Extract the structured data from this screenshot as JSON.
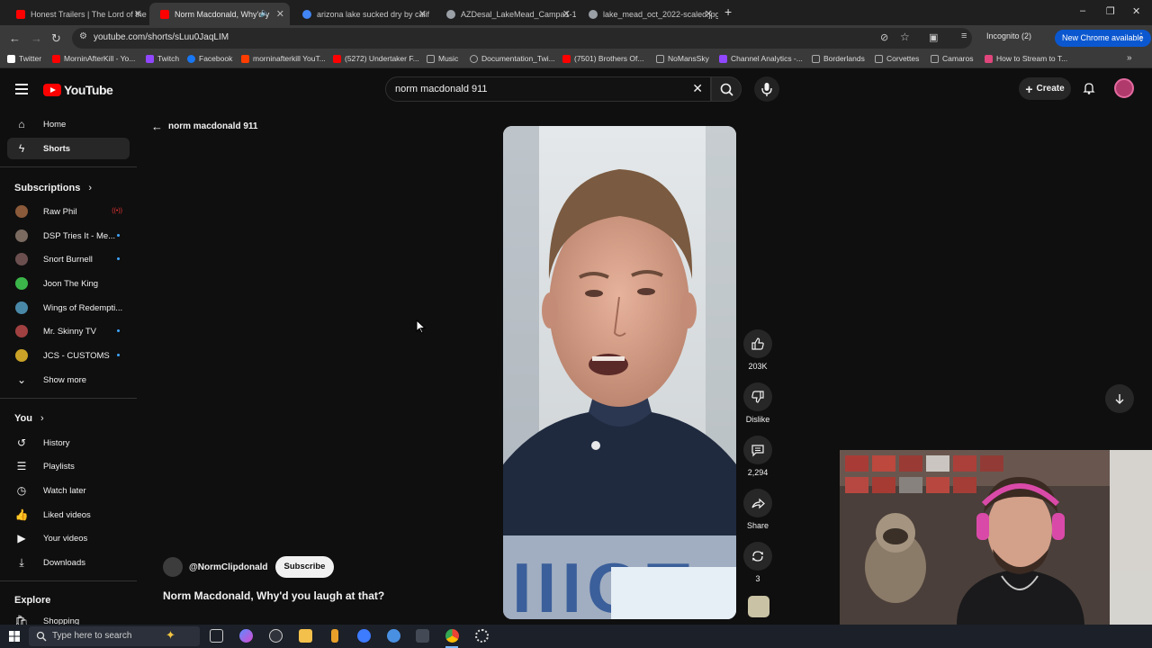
{
  "browser": {
    "tabs": [
      {
        "title": "Honest Trailers | The Lord of the",
        "favicon_color": "#ff0000"
      },
      {
        "title": "Norm Macdonald, Why'd y",
        "favicon_color": "#ff0000",
        "active": true
      },
      {
        "title": "arizona lake sucked dry by calif",
        "favicon_color": "#4285f4"
      },
      {
        "title": "AZDesal_LakeMead_Campa1-1",
        "favicon_color": "#9aa0a6"
      },
      {
        "title": "lake_mead_oct_2022-scaled.jpg",
        "favicon_color": "#9aa0a6"
      }
    ],
    "url": "youtube.com/shorts/sLuu0JaqLIM",
    "incognito_label": "Incognito (2)",
    "new_chrome_label": "New Chrome available",
    "bookmarks": [
      {
        "label": "Twitter",
        "color": "#ffffff"
      },
      {
        "label": "MorninAfterKill - Yo...",
        "color": "#ff0000"
      },
      {
        "label": "Twitch",
        "color": "#9146ff"
      },
      {
        "label": "Facebook",
        "color": "#1877f2"
      },
      {
        "label": "morninafterkill YouT...",
        "color": "#ff3d00"
      },
      {
        "label": "(5272) Undertaker F...",
        "color": "#ff0000"
      },
      {
        "label": "Music",
        "color": "#9aa0a6"
      },
      {
        "label": "Documentation_Twi...",
        "color": "#9aa0a6"
      },
      {
        "label": "(7501) Brothers Of...",
        "color": "#ff0000"
      },
      {
        "label": "NoMansSky",
        "color": "#9aa0a6"
      },
      {
        "label": "Channel Analytics -...",
        "color": "#9146ff"
      },
      {
        "label": "Borderlands",
        "color": "#9aa0a6"
      },
      {
        "label": "Corvettes",
        "color": "#9aa0a6"
      },
      {
        "label": "Camaros",
        "color": "#9aa0a6"
      },
      {
        "label": "How to Stream to T...",
        "color": "#e0457b"
      }
    ]
  },
  "youtube": {
    "logo": "YouTube",
    "search_query": "norm macdonald 911",
    "create_label": "Create",
    "sidebar": {
      "main": [
        {
          "label": "Home",
          "icon": "home-icon"
        },
        {
          "label": "Shorts",
          "icon": "shorts-icon",
          "active": true
        }
      ],
      "subscriptions_title": "Subscriptions",
      "subscriptions": [
        {
          "label": "Raw Phil",
          "color": "#8a5a3a",
          "live": true
        },
        {
          "label": "DSP Tries It - Me...",
          "color": "#7a6a60",
          "new": true
        },
        {
          "label": "Snort Burnell",
          "color": "#6b4f4f",
          "new": true
        },
        {
          "label": "Joon The King",
          "color": "#3bb54a",
          "new": false
        },
        {
          "label": "Wings of Redempti...",
          "color": "#4a88a8",
          "new": false
        },
        {
          "label": "Mr. Skinny TV",
          "color": "#a04040",
          "new": true
        },
        {
          "label": "JCS - CUSTOMS",
          "color": "#c9a227",
          "new": true
        }
      ],
      "show_more": "Show more",
      "you_title": "You",
      "you": [
        {
          "label": "History",
          "icon": "history-icon"
        },
        {
          "label": "Playlists",
          "icon": "playlists-icon"
        },
        {
          "label": "Watch later",
          "icon": "watch-later-icon"
        },
        {
          "label": "Liked videos",
          "icon": "liked-videos-icon"
        },
        {
          "label": "Your videos",
          "icon": "your-videos-icon"
        },
        {
          "label": "Downloads",
          "icon": "downloads-icon"
        }
      ],
      "explore_title": "Explore",
      "explore_first": "Shopping"
    },
    "back_label": "norm macdonald 911",
    "short": {
      "channel": "@NormClipdonald",
      "subscribe_label": "Subscribe",
      "title": "Norm Macdonald, Why'd you laugh at that?",
      "likes": "203K",
      "dislike_label": "Dislike",
      "comments": "2,294",
      "share_label": "Share",
      "remix_count": "3"
    }
  },
  "taskbar": {
    "search_placeholder": "Type here to search"
  }
}
